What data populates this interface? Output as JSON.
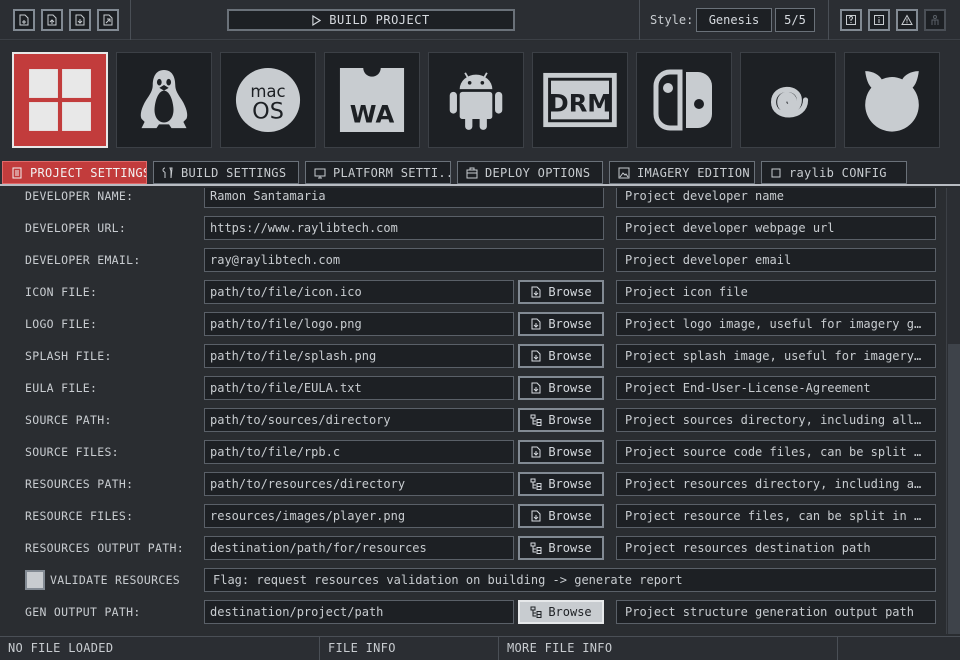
{
  "toolbar": {
    "build_label": "BUILD PROJECT",
    "style_label": "Style:",
    "style_value": "Genesis",
    "style_count": "5/5",
    "file_icons": [
      "new-file-icon",
      "open-file-icon",
      "save-file-icon",
      "export-file-icon"
    ],
    "help_icons": [
      "help-icon",
      "info-icon",
      "warning-icon",
      "user-icon"
    ]
  },
  "platforms": [
    {
      "name": "windows",
      "active": true
    },
    {
      "name": "linux",
      "active": false
    },
    {
      "name": "macos",
      "active": false,
      "text_top": "mac",
      "text_bottom": "OS"
    },
    {
      "name": "webassembly",
      "active": false,
      "text": "WA"
    },
    {
      "name": "android",
      "active": false
    },
    {
      "name": "drm",
      "active": false,
      "text": "DRM"
    },
    {
      "name": "switch",
      "active": false
    },
    {
      "name": "dreamcast",
      "active": false
    },
    {
      "name": "freebsd",
      "active": false
    }
  ],
  "tabs": [
    {
      "label": "PROJECT SETTINGS",
      "icon": "document-icon",
      "active": true
    },
    {
      "label": "BUILD SETTINGS",
      "icon": "tools-icon",
      "active": false
    },
    {
      "label": "PLATFORM SETTI...",
      "icon": "monitor-icon",
      "active": false
    },
    {
      "label": "DEPLOY OPTIONS",
      "icon": "package-icon",
      "active": false
    },
    {
      "label": "IMAGERY EDITION",
      "icon": "image-icon",
      "active": false
    },
    {
      "label": "raylib CONFIG",
      "icon": "checkbox-icon",
      "active": false
    }
  ],
  "rows": {
    "developer_name": {
      "label": "DEVELOPER NAME:",
      "value": "Ramon Santamaria",
      "desc": "Project developer name"
    },
    "developer_url": {
      "label": "DEVELOPER URL:",
      "value": "https://www.raylibtech.com",
      "desc": "Project developer webpage url"
    },
    "developer_email": {
      "label": "DEVELOPER EMAIL:",
      "value": "ray@raylibtech.com",
      "desc": "Project developer email"
    },
    "icon_file": {
      "label": "ICON FILE:",
      "value": "path/to/file/icon.ico",
      "browse": "Browse",
      "desc": "Project icon file"
    },
    "logo_file": {
      "label": "LOGO FILE:",
      "value": "path/to/file/logo.png",
      "browse": "Browse",
      "desc": "Project logo image, useful for imagery gener..."
    },
    "splash_file": {
      "label": "SPLASH FILE:",
      "value": "path/to/file/splash.png",
      "browse": "Browse",
      "desc": "Project splash image, useful for imagery gen..."
    },
    "eula_file": {
      "label": "EULA FILE:",
      "value": "path/to/file/EULA.txt",
      "browse": "Browse",
      "desc": "Project End-User-License-Agreement"
    },
    "source_path": {
      "label": "SOURCE PATH:",
      "value": "path/to/sources/directory",
      "browse": "Browse",
      "desc": "Project sources directory, including all requ..."
    },
    "source_files": {
      "label": "SOURCE FILES:",
      "value": "path/to/file/rpb.c",
      "browse": "Browse",
      "desc": "Project source code files, can be split in mul..."
    },
    "resources_path": {
      "label": "RESOURCES PATH:",
      "value": "path/to/resources/directory",
      "browse": "Browse",
      "desc": "Project resources directory, including all re..."
    },
    "resource_files": {
      "label": "RESOURCE FILES:",
      "value": "resources/images/player.png",
      "browse": "Browse",
      "desc": "Project resource files, can be split in multip..."
    },
    "resources_output": {
      "label": "RESOURCES OUTPUT PATH:",
      "value": "destination/path/for/resources",
      "browse": "Browse",
      "desc": "Project resources destination path"
    },
    "validate": {
      "label": "VALIDATE RESOURCES",
      "desc": "Flag: request resources validation on building -> generate report",
      "checked": false
    },
    "gen_output": {
      "label": "GEN OUTPUT PATH:",
      "value": "destination/project/path",
      "browse": "Browse",
      "desc": "Project structure generation output path"
    }
  },
  "status": {
    "file_loaded": "NO FILE LOADED",
    "file_info": "FILE INFO",
    "more_info": "MORE FILE INFO"
  },
  "colors": {
    "accent": "#c23c3c",
    "background": "#2a2d31",
    "field": "#1d2024",
    "text": "#c8ccd0"
  }
}
